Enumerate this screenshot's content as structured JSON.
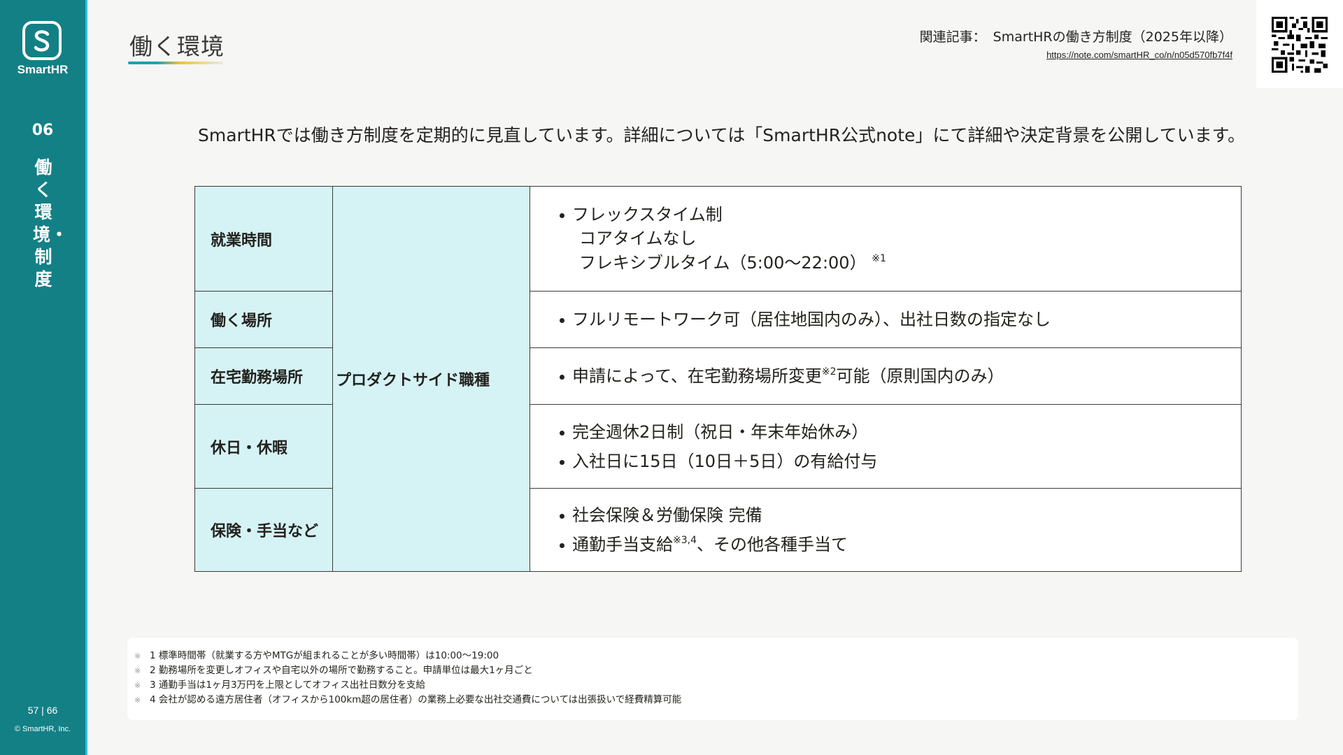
{
  "sidebar": {
    "logo_text": "SmartHR",
    "chapter_number": "06",
    "chapter_title": "働く環境・制度",
    "page_number": "57 | 66",
    "copyright": "© SmartHR, Inc."
  },
  "header": {
    "title": "働く環境",
    "related_label": "関連記事：",
    "related_title": "SmartHRの働き方制度（2025年以降）",
    "related_url": "https://note.com/smartHR_co/n/n05d570fb7f4f"
  },
  "lead": "SmartHRでは働き方制度を定期的に見直しています。詳細については「SmartHR公式note」にて詳細や決定背景を公開しています。",
  "table": {
    "group_label": "プロダクトサイド職種",
    "rows": [
      {
        "category": "就業時間",
        "bullet": "フレックスタイム制",
        "sub1": "コアタイムなし",
        "sub2": "フレキシブルタイム（5:00〜22:00）",
        "sub2_note": "※1"
      },
      {
        "category": "働く場所",
        "bullet": "フルリモートワーク可（居住地国内のみ）、出社日数の指定なし"
      },
      {
        "category": "在宅勤務場所",
        "bullet_a": "申請によって、在宅勤務場所変更",
        "bullet_note": "※2",
        "bullet_b": "可能（原則国内のみ）"
      },
      {
        "category": "休日・休暇",
        "bullet1": "完全週休2日制（祝日・年末年始休み）",
        "bullet2": "入社日に15日（10日＋5日）の有給付与"
      },
      {
        "category": "保険・手当など",
        "bullet1": "社会保険＆労働保険 完備",
        "bullet2_a": "通勤手当支給",
        "bullet2_note": "※3,4",
        "bullet2_b": "、その他各種手当て"
      }
    ]
  },
  "footnotes": {
    "mark": "※",
    "items": [
      "1 標準時間帯（就業する方やMTGが組まれることが多い時間帯）は10:00〜19:00",
      "2 勤務場所を変更しオフィスや自宅以外の場所で勤務すること。申請単位は最大1ヶ月ごと",
      "3 通勤手当は1ヶ月3万円を上限としてオフィス出社日数分を支給",
      "4 会社が認める遠方居住者（オフィスから100km超の居住者）の業務上必要な出社交通費については出張扱いで経費精算可能"
    ]
  },
  "colors": {
    "sidebar": "#138086",
    "sidebar_edge": "#2ec1cf",
    "cell_highlight": "#d5f3f5"
  }
}
